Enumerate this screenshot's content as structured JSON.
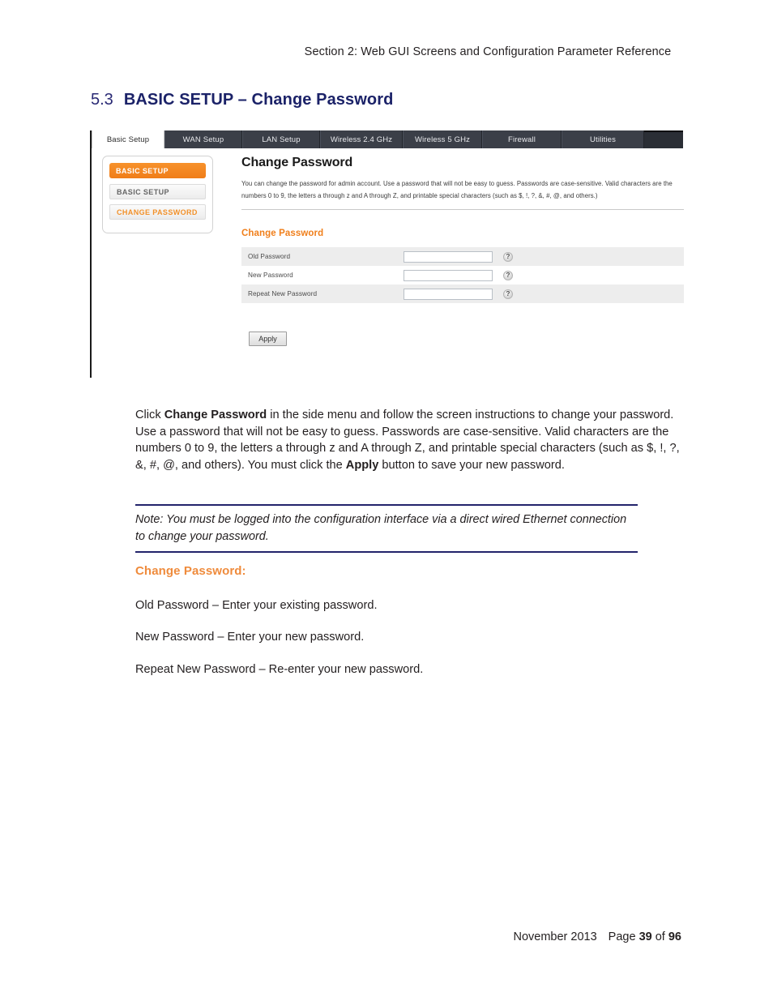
{
  "running_head": "Section 2:  Web GUI Screens and Configuration Parameter Reference",
  "section": {
    "number": "5.3",
    "title": "BASIC SETUP – Change Password"
  },
  "screenshot": {
    "tabs": [
      {
        "label": "Basic Setup",
        "active": true
      },
      {
        "label": "WAN Setup",
        "active": false
      },
      {
        "label": "LAN Setup",
        "active": false
      },
      {
        "label": "Wireless 2.4 GHz",
        "active": false
      },
      {
        "label": "Wireless 5 GHz",
        "active": false
      },
      {
        "label": "Firewall",
        "active": false
      },
      {
        "label": "Utilities",
        "active": false
      }
    ],
    "side_menu": {
      "header": "BASIC SETUP",
      "items": [
        {
          "label": "BASIC SETUP",
          "selected": false
        },
        {
          "label": "CHANGE PASSWORD",
          "selected": true
        }
      ]
    },
    "panel": {
      "title": "Change Password",
      "description": "You can change the password for admin account. Use a password that will not be easy to guess. Passwords are case-sensitive. Valid characters are the numbers 0 to 9, the letters a through z and A through Z, and printable special characters (such as $, !, ?, &, #, @, and others.)",
      "form_title": "Change Password",
      "fields": [
        {
          "label": "Old Password",
          "value": "",
          "help": "?"
        },
        {
          "label": "New Password",
          "value": "",
          "help": "?"
        },
        {
          "label": "Repeat New Password",
          "value": "",
          "help": "?"
        }
      ],
      "apply_label": "Apply"
    }
  },
  "body": {
    "paragraph_parts": {
      "p1": "Click ",
      "b1": "Change Password",
      "p2": " in the side menu and follow the screen instructions to change your password.   Use a password that will not be easy to guess.  Passwords are case-sensitive.  Valid characters are the numbers 0 to 9, the letters a through z and A through Z, and printable special characters (such as $, !, ?, &, #, @, and others).  You must click the ",
      "b2": "Apply",
      "p3": " button to save your new password."
    },
    "note": "Note:  You must be logged into the configuration interface via a direct wired Ethernet connection to change your password.",
    "subheading": "Change Password:",
    "definitions": [
      "Old Password – Enter your existing password.",
      "New Password – Enter your new password.",
      "Repeat New Password – Re-enter your new password."
    ]
  },
  "footer": {
    "date": "November 2013",
    "page_word": "Page",
    "page_number": "39",
    "of_word": "of",
    "total_pages": "96"
  }
}
